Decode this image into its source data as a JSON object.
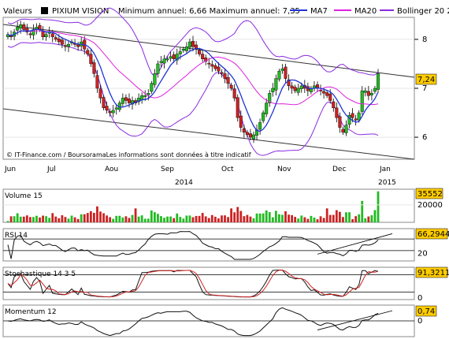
{
  "header": {
    "label_valeurs": "Valeurs",
    "stock_name": "PIXIUM VISION",
    "range_text": "Minimum annuel: 6,66 Maximum annuel: 7,35",
    "legend": [
      {
        "name": "MA7",
        "color": "#1f34d6"
      },
      {
        "name": "MA20",
        "color": "#dd22dd"
      },
      {
        "name": "Bollinger 20 2.0",
        "color": "#8a2be2"
      }
    ]
  },
  "credit": "© IT-Finance.com / BoursoramaLes informations sont données à titre indicatif",
  "x_axis": {
    "months": [
      "Jun",
      "Jul",
      "Aou",
      "Sep",
      "Oct",
      "Nov",
      "Dec",
      "Jan"
    ],
    "year_labels": [
      "2014",
      "2015"
    ]
  },
  "colors": {
    "up": "#22bb22",
    "down": "#cc2222",
    "price_box": "#ffcc00",
    "channel": "#333333",
    "grid": "#e6e6e6"
  },
  "chart_data": [
    {
      "type": "candlestick",
      "title": "PIXIUM VISION",
      "y_ticks": [
        6,
        7,
        8
      ],
      "ylim": [
        5.55,
        8.45
      ],
      "last_value_label": "7,24",
      "last_value": 7.24,
      "series_close": [
        8.1,
        8.05,
        8.15,
        8.25,
        8.3,
        8.2,
        8.15,
        8.1,
        8.2,
        8.25,
        8.2,
        8.05,
        8.1,
        8.15,
        8.05,
        8.0,
        7.95,
        7.9,
        7.85,
        7.9,
        7.95,
        7.9,
        7.85,
        7.95,
        7.8,
        7.7,
        7.5,
        7.3,
        7.0,
        6.8,
        6.6,
        6.55,
        6.5,
        6.55,
        6.6,
        6.7,
        6.8,
        6.75,
        6.7,
        6.75,
        6.7,
        6.8,
        6.85,
        6.85,
        6.9,
        7.1,
        7.3,
        7.5,
        7.55,
        7.6,
        7.6,
        7.65,
        7.6,
        7.7,
        7.75,
        7.8,
        7.85,
        7.95,
        7.85,
        7.8,
        7.7,
        7.6,
        7.55,
        7.5,
        7.45,
        7.4,
        7.35,
        7.3,
        7.2,
        7.1,
        7.0,
        6.8,
        6.4,
        6.2,
        6.1,
        6.05,
        6.0,
        6.05,
        6.15,
        6.3,
        6.5,
        6.7,
        6.9,
        7.0,
        7.2,
        7.35,
        7.4,
        7.2,
        7.05,
        7.0,
        6.95,
        7.0,
        7.05,
        7.0,
        6.95,
        7.0,
        7.05,
        7.0,
        6.95,
        6.9,
        6.85,
        6.75,
        6.6,
        6.4,
        6.2,
        6.1,
        6.25,
        6.45,
        6.4,
        6.35,
        6.5,
        6.95,
        6.95,
        6.85,
        6.9,
        7.0,
        7.3
      ],
      "bollinger_upper_level_range": [
        6.9,
        8.4
      ],
      "bollinger_lower_level_range": [
        5.75,
        7.6
      ],
      "trend_channel": "descending"
    },
    {
      "type": "bar",
      "title": "Volume 15",
      "y_ticks": [
        20000
      ],
      "last_value_label": "35552",
      "last_value": 35552
    },
    {
      "type": "line",
      "title": "RSI 14",
      "y_ticks": [
        20
      ],
      "levels": [
        30,
        70
      ],
      "ylim": [
        0,
        100
      ],
      "last_value_label": "66,2944",
      "last_value": 66.2944
    },
    {
      "type": "line",
      "title": "Stochastique 14 3 5",
      "y_ticks": [
        0
      ],
      "levels": [
        20,
        80
      ],
      "ylim": [
        0,
        100
      ],
      "last_value_label": "91,3211",
      "last_value": 91.3211
    },
    {
      "type": "line",
      "title": "Momentum 12",
      "y_ticks": [
        0
      ],
      "levels": [
        0
      ],
      "last_value_label": "0,74",
      "last_value": 0.74
    }
  ]
}
